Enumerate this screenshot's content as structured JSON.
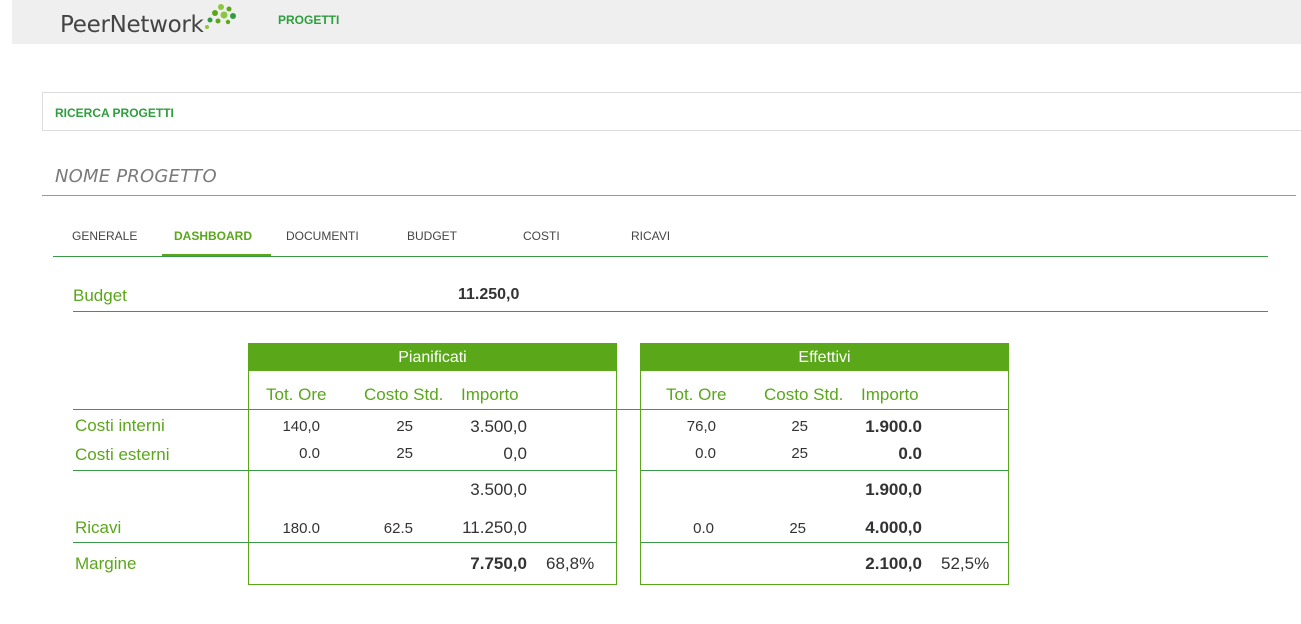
{
  "header": {
    "logo_text": "PeerNetwork",
    "nav_projects": "PROGETTI"
  },
  "search": {
    "label": "RICERCA PROGETTI"
  },
  "project": {
    "title": "NOME PROGETTO"
  },
  "tabs": [
    "GENERALE",
    "DASHBOARD",
    "DOCUMENTI",
    "BUDGET",
    "COSTI",
    "RICAVI"
  ],
  "active_tab": "DASHBOARD",
  "budget": {
    "label": "Budget",
    "value": "11.250,0"
  },
  "row_labels": {
    "costi_interni": "Costi interni",
    "costi_esterni": "Costi esterni",
    "ricavi": "Ricavi",
    "margine": "Margine"
  },
  "columns": {
    "tot_ore": "Tot. Ore",
    "costo_std": "Costo Std.",
    "importo": "Importo"
  },
  "pianificati": {
    "title": "Pianificati",
    "costi_interni": {
      "ore": "140,0",
      "costo": "25",
      "importo": "3.500,0"
    },
    "costi_esterni": {
      "ore": "0.0",
      "costo": "25",
      "importo": "0,0"
    },
    "subtotal": "3.500,0",
    "ricavi": {
      "ore": "180.0",
      "costo": "62.5",
      "importo": "11.250,0"
    },
    "margine": {
      "importo": "7.750,0",
      "pct": "68,8%"
    }
  },
  "effettivi": {
    "title": "Effettivi",
    "costi_interni": {
      "ore": "76,0",
      "costo": "25",
      "importo": "1.900.0"
    },
    "costi_esterni": {
      "ore": "0.0",
      "costo": "25",
      "importo": "0.0"
    },
    "subtotal": "1.900,0",
    "ricavi": {
      "ore": "0.0",
      "costo": "25",
      "importo": "4.000,0"
    },
    "margine": {
      "importo": "2.100,0",
      "pct": "52,5%"
    }
  },
  "colors": {
    "accent": "#5aa71a",
    "nav_green": "#2e9e3e",
    "rule": "#3a9a4a",
    "header_bg": "#efefef"
  }
}
